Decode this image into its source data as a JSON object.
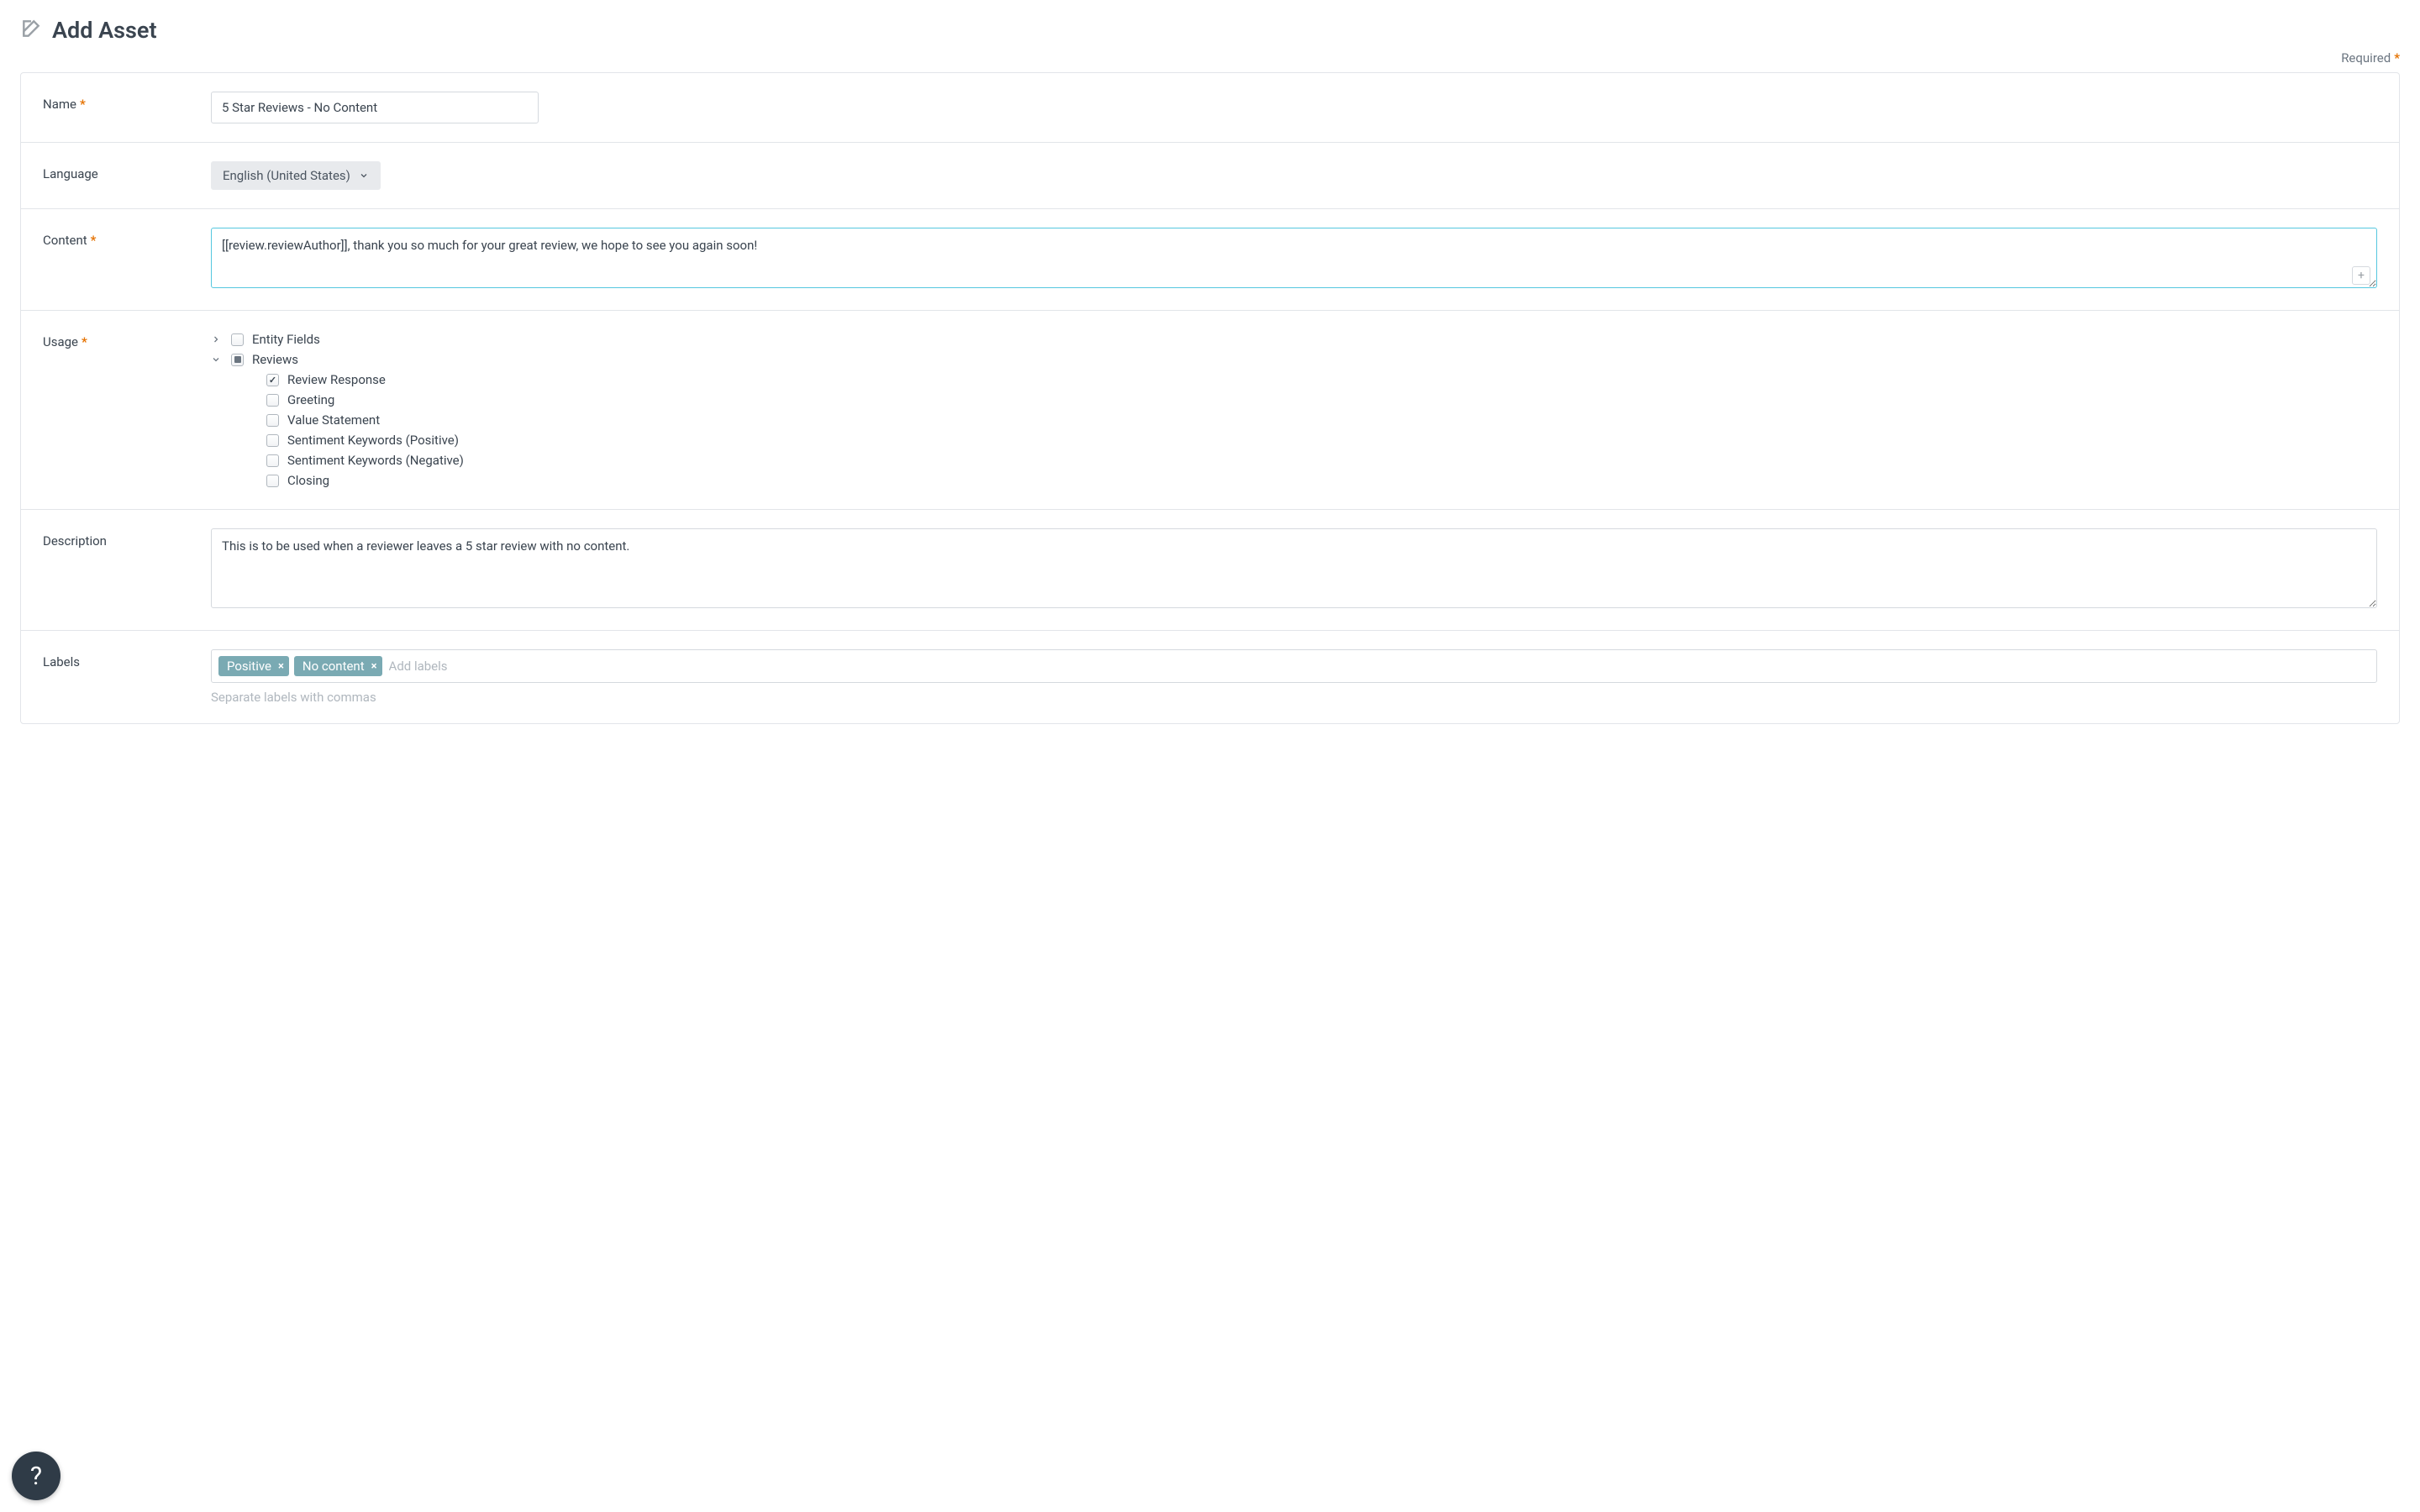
{
  "header": {
    "title": "Add Asset"
  },
  "required_label": "Required",
  "form": {
    "name": {
      "label": "Name",
      "value": "5 Star Reviews - No Content",
      "required": true
    },
    "language": {
      "label": "Language",
      "selected": "English (United States)"
    },
    "content": {
      "label": "Content",
      "value": "[[review.reviewAuthor]], thank you so much for your great review, we hope to see you again soon!",
      "required": true
    },
    "usage": {
      "label": "Usage",
      "required": true,
      "tree": {
        "entity_fields": {
          "label": "Entity Fields",
          "expanded": false,
          "checked": false
        },
        "reviews": {
          "label": "Reviews",
          "expanded": true,
          "state": "indeterminate",
          "children": [
            {
              "key": "review_response",
              "label": "Review Response",
              "checked": true
            },
            {
              "key": "greeting",
              "label": "Greeting",
              "checked": false
            },
            {
              "key": "value_statement",
              "label": "Value Statement",
              "checked": false
            },
            {
              "key": "sentiment_positive",
              "label": "Sentiment Keywords (Positive)",
              "checked": false
            },
            {
              "key": "sentiment_negative",
              "label": "Sentiment Keywords (Negative)",
              "checked": false
            },
            {
              "key": "closing",
              "label": "Closing",
              "checked": false
            }
          ]
        }
      }
    },
    "description": {
      "label": "Description",
      "value": "This is to be used when a reviewer leaves a 5 star review with no content."
    },
    "labels": {
      "label": "Labels",
      "tags": [
        "Positive",
        "No content"
      ],
      "placeholder": "Add labels",
      "help": "Separate labels with commas"
    }
  }
}
